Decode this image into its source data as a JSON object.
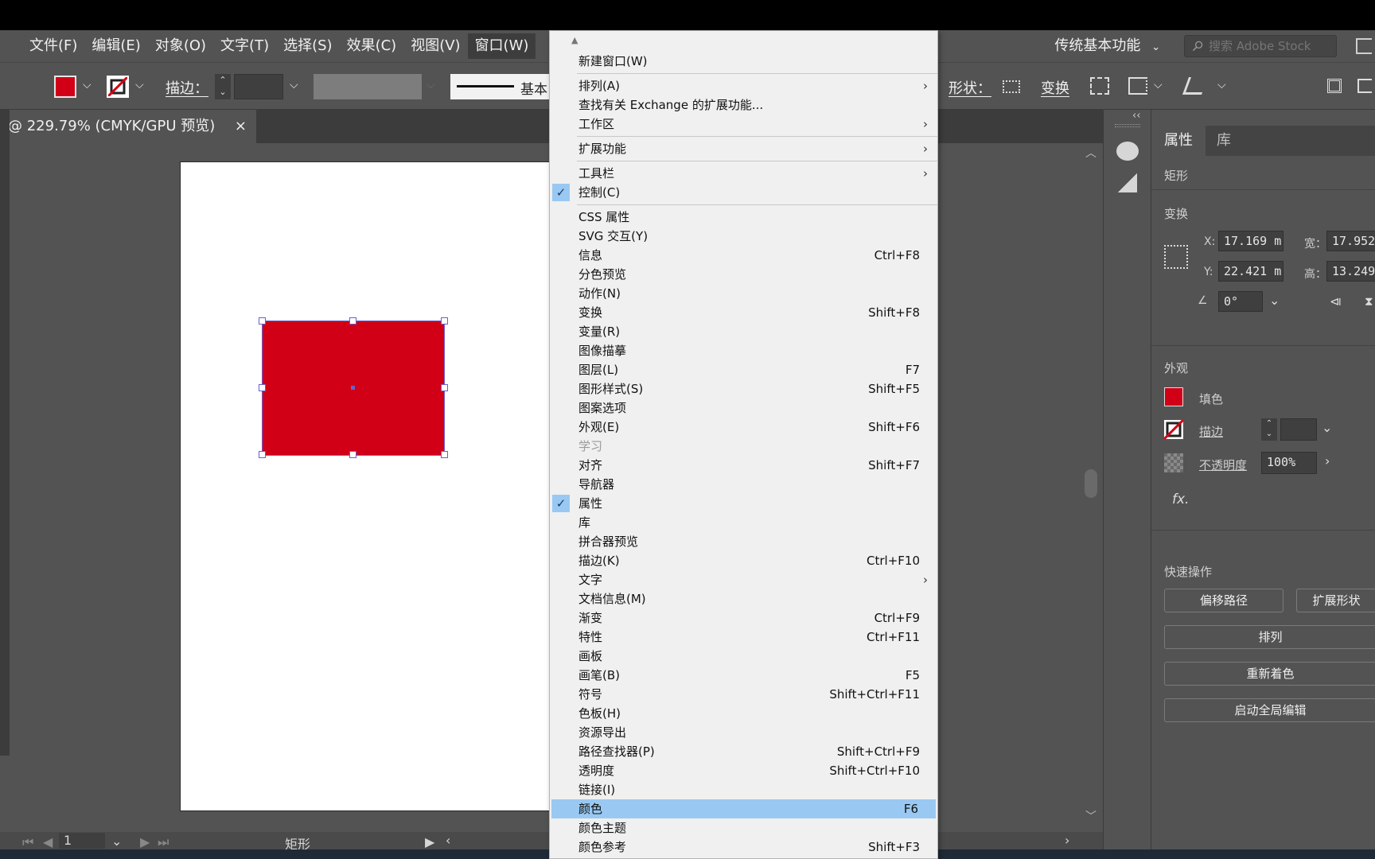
{
  "menubar": {
    "items": [
      "文件(F)",
      "编辑(E)",
      "对象(O)",
      "文字(T)",
      "选择(S)",
      "效果(C)",
      "视图(V)",
      "窗口(W)"
    ],
    "workspace_label": "传统基本功能",
    "search_placeholder": "搜索 Adobe Stock"
  },
  "controlbar": {
    "stroke_label": "描边：",
    "stroke_style_label": "基本",
    "shape_label": "形状：",
    "transform_label": "变换"
  },
  "document_tab": {
    "title": "@ 229.79% (CMYK/GPU 预览)",
    "close": "×"
  },
  "statusbar": {
    "page_number": "1",
    "object_type": "矩形"
  },
  "colors": {
    "fill": "#d20016",
    "menu_highlight": "#99c9f2",
    "selection": "#6b5fd0"
  },
  "window_menu": {
    "items": [
      {
        "label": "新建窗口(W)",
        "shortcut": "",
        "submenu": false,
        "checked": false,
        "disabled": false,
        "highlight": false
      },
      {
        "label": "排列(A)",
        "shortcut": "",
        "submenu": true,
        "checked": false,
        "disabled": false,
        "highlight": false
      },
      {
        "label": "查找有关 Exchange 的扩展功能...",
        "shortcut": "",
        "submenu": false,
        "checked": false,
        "disabled": false,
        "highlight": false
      },
      {
        "label": "工作区",
        "shortcut": "",
        "submenu": true,
        "checked": false,
        "disabled": false,
        "highlight": false
      },
      {
        "label": "扩展功能",
        "shortcut": "",
        "submenu": true,
        "checked": false,
        "disabled": false,
        "highlight": false
      },
      {
        "label": "工具栏",
        "shortcut": "",
        "submenu": true,
        "checked": false,
        "disabled": false,
        "highlight": false
      },
      {
        "label": "控制(C)",
        "shortcut": "",
        "submenu": false,
        "checked": true,
        "disabled": false,
        "highlight": false
      },
      {
        "label": "CSS 属性",
        "shortcut": "",
        "submenu": false,
        "checked": false,
        "disabled": false,
        "highlight": false
      },
      {
        "label": "SVG 交互(Y)",
        "shortcut": "",
        "submenu": false,
        "checked": false,
        "disabled": false,
        "highlight": false
      },
      {
        "label": "信息",
        "shortcut": "Ctrl+F8",
        "submenu": false,
        "checked": false,
        "disabled": false,
        "highlight": false
      },
      {
        "label": "分色预览",
        "shortcut": "",
        "submenu": false,
        "checked": false,
        "disabled": false,
        "highlight": false
      },
      {
        "label": "动作(N)",
        "shortcut": "",
        "submenu": false,
        "checked": false,
        "disabled": false,
        "highlight": false
      },
      {
        "label": "变换",
        "shortcut": "Shift+F8",
        "submenu": false,
        "checked": false,
        "disabled": false,
        "highlight": false
      },
      {
        "label": "变量(R)",
        "shortcut": "",
        "submenu": false,
        "checked": false,
        "disabled": false,
        "highlight": false
      },
      {
        "label": "图像描摹",
        "shortcut": "",
        "submenu": false,
        "checked": false,
        "disabled": false,
        "highlight": false
      },
      {
        "label": "图层(L)",
        "shortcut": "F7",
        "submenu": false,
        "checked": false,
        "disabled": false,
        "highlight": false
      },
      {
        "label": "图形样式(S)",
        "shortcut": "Shift+F5",
        "submenu": false,
        "checked": false,
        "disabled": false,
        "highlight": false
      },
      {
        "label": "图案选项",
        "shortcut": "",
        "submenu": false,
        "checked": false,
        "disabled": false,
        "highlight": false
      },
      {
        "label": "外观(E)",
        "shortcut": "Shift+F6",
        "submenu": false,
        "checked": false,
        "disabled": false,
        "highlight": false
      },
      {
        "label": "学习",
        "shortcut": "",
        "submenu": false,
        "checked": false,
        "disabled": true,
        "highlight": false
      },
      {
        "label": "对齐",
        "shortcut": "Shift+F7",
        "submenu": false,
        "checked": false,
        "disabled": false,
        "highlight": false
      },
      {
        "label": "导航器",
        "shortcut": "",
        "submenu": false,
        "checked": false,
        "disabled": false,
        "highlight": false
      },
      {
        "label": "属性",
        "shortcut": "",
        "submenu": false,
        "checked": true,
        "disabled": false,
        "highlight": false
      },
      {
        "label": "库",
        "shortcut": "",
        "submenu": false,
        "checked": false,
        "disabled": false,
        "highlight": false
      },
      {
        "label": "拼合器预览",
        "shortcut": "",
        "submenu": false,
        "checked": false,
        "disabled": false,
        "highlight": false
      },
      {
        "label": "描边(K)",
        "shortcut": "Ctrl+F10",
        "submenu": false,
        "checked": false,
        "disabled": false,
        "highlight": false
      },
      {
        "label": "文字",
        "shortcut": "",
        "submenu": true,
        "checked": false,
        "disabled": false,
        "highlight": false
      },
      {
        "label": "文档信息(M)",
        "shortcut": "",
        "submenu": false,
        "checked": false,
        "disabled": false,
        "highlight": false
      },
      {
        "label": "渐变",
        "shortcut": "Ctrl+F9",
        "submenu": false,
        "checked": false,
        "disabled": false,
        "highlight": false
      },
      {
        "label": "特性",
        "shortcut": "Ctrl+F11",
        "submenu": false,
        "checked": false,
        "disabled": false,
        "highlight": false
      },
      {
        "label": "画板",
        "shortcut": "",
        "submenu": false,
        "checked": false,
        "disabled": false,
        "highlight": false
      },
      {
        "label": "画笔(B)",
        "shortcut": "F5",
        "submenu": false,
        "checked": false,
        "disabled": false,
        "highlight": false
      },
      {
        "label": "符号",
        "shortcut": "Shift+Ctrl+F11",
        "submenu": false,
        "checked": false,
        "disabled": false,
        "highlight": false
      },
      {
        "label": "色板(H)",
        "shortcut": "",
        "submenu": false,
        "checked": false,
        "disabled": false,
        "highlight": false
      },
      {
        "label": "资源导出",
        "shortcut": "",
        "submenu": false,
        "checked": false,
        "disabled": false,
        "highlight": false
      },
      {
        "label": "路径查找器(P)",
        "shortcut": "Shift+Ctrl+F9",
        "submenu": false,
        "checked": false,
        "disabled": false,
        "highlight": false
      },
      {
        "label": "透明度",
        "shortcut": "Shift+Ctrl+F10",
        "submenu": false,
        "checked": false,
        "disabled": false,
        "highlight": false
      },
      {
        "label": "链接(I)",
        "shortcut": "",
        "submenu": false,
        "checked": false,
        "disabled": false,
        "highlight": false
      },
      {
        "label": "颜色",
        "shortcut": "F6",
        "submenu": false,
        "checked": false,
        "disabled": false,
        "highlight": true
      },
      {
        "label": "颜色主题",
        "shortcut": "",
        "submenu": false,
        "checked": false,
        "disabled": false,
        "highlight": false
      },
      {
        "label": "颜色参考",
        "shortcut": "Shift+F3",
        "submenu": false,
        "checked": false,
        "disabled": false,
        "highlight": false
      }
    ]
  },
  "properties_panel": {
    "tab_properties": "属性",
    "tab_library": "库",
    "object_type": "矩形",
    "transform_title": "变换",
    "x_label": "X:",
    "x_value": "17.169 m",
    "y_label": "Y:",
    "y_value": "22.421 m",
    "w_label": "宽：",
    "w_value": "17.952",
    "h_label": "高：",
    "h_value": "13.249",
    "angle_value": "0°",
    "appearance_title": "外观",
    "fill_label": "填色",
    "stroke_label": "描边",
    "opacity_label": "不透明度",
    "opacity_value": "100%",
    "fx_label": "fx.",
    "quick_actions_title": "快速操作",
    "btn_offset_path": "偏移路径",
    "btn_expand_shape": "扩展形状",
    "btn_arrange": "排列",
    "btn_recolor": "重新着色",
    "btn_global_edit": "启动全局编辑"
  }
}
